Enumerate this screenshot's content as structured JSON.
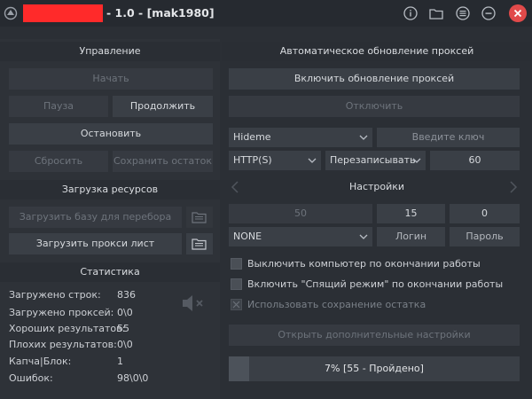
{
  "window": {
    "title": "- 1.0 - [mak1980]",
    "accent_red": "#ff2a2a",
    "icons": [
      "info-icon",
      "folder-icon",
      "menu-icon",
      "minimize-icon",
      "close-icon"
    ]
  },
  "control": {
    "header": "Управление",
    "start": "Начать",
    "pause": "Пауза",
    "continue": "Продолжить",
    "stop": "Остановить",
    "reset": "Сбросить",
    "save_rest": "Сохранить остаток"
  },
  "resources": {
    "header": "Загрузка ресурсов",
    "load_base": "Загрузить базу для перебора",
    "load_proxy": "Загрузить прокси лист"
  },
  "stats": {
    "header": "Статистика",
    "rows": [
      {
        "label": "Загружено строк:",
        "value": "836"
      },
      {
        "label": "Загружено проксей:",
        "value": "0\\0"
      },
      {
        "label": "Хороших результатов:",
        "value": "55"
      },
      {
        "label": "Плохих результатов:",
        "value": "0\\0"
      },
      {
        "label": "Капча|Блок:",
        "value": "1"
      },
      {
        "label": "Ошибок:",
        "value": "98\\0\\0"
      }
    ],
    "sound_icon": "speaker-muted-icon"
  },
  "proxy_update": {
    "header": "Автоматическое обновление проксей",
    "enable": "Включить обновление проксей",
    "disable": "Отключить",
    "service": "Hideme",
    "key_placeholder": "Введите ключ",
    "protocol": "HTTP(S)",
    "mode": "Перезаписывать",
    "interval": "60"
  },
  "settings": {
    "header": "Настройки",
    "field1": "50",
    "field2": "15",
    "field3": "0",
    "proxy_type": "NONE",
    "login": "Логин",
    "password": "Пароль",
    "checks": [
      {
        "label": "Выключить компьютер по окончании работы",
        "disabled": false
      },
      {
        "label": "Включить \"Спящий режим\" по окончании работы",
        "disabled": false
      },
      {
        "label": "Использовать сохранение остатка",
        "disabled": true
      }
    ],
    "more": "Открыть дополнительные настройки"
  },
  "progress": {
    "text": "7% [55 - Пройдено]",
    "fraction": 0.07
  }
}
